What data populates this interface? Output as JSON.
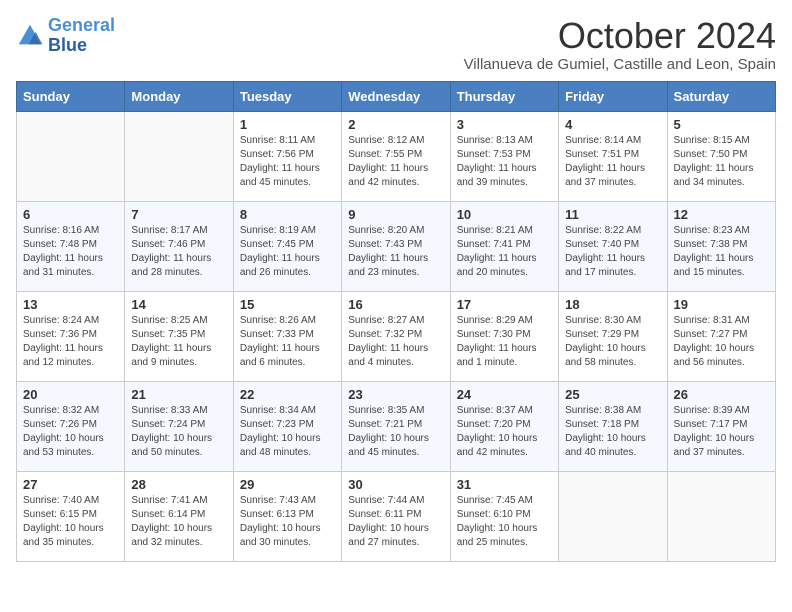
{
  "logo": {
    "line1": "General",
    "line2": "Blue"
  },
  "title": "October 2024",
  "subtitle": "Villanueva de Gumiel, Castille and Leon, Spain",
  "days_of_week": [
    "Sunday",
    "Monday",
    "Tuesday",
    "Wednesday",
    "Thursday",
    "Friday",
    "Saturday"
  ],
  "weeks": [
    [
      {
        "day": "",
        "detail": ""
      },
      {
        "day": "",
        "detail": ""
      },
      {
        "day": "1",
        "detail": "Sunrise: 8:11 AM\nSunset: 7:56 PM\nDaylight: 11 hours and 45 minutes."
      },
      {
        "day": "2",
        "detail": "Sunrise: 8:12 AM\nSunset: 7:55 PM\nDaylight: 11 hours and 42 minutes."
      },
      {
        "day": "3",
        "detail": "Sunrise: 8:13 AM\nSunset: 7:53 PM\nDaylight: 11 hours and 39 minutes."
      },
      {
        "day": "4",
        "detail": "Sunrise: 8:14 AM\nSunset: 7:51 PM\nDaylight: 11 hours and 37 minutes."
      },
      {
        "day": "5",
        "detail": "Sunrise: 8:15 AM\nSunset: 7:50 PM\nDaylight: 11 hours and 34 minutes."
      }
    ],
    [
      {
        "day": "6",
        "detail": "Sunrise: 8:16 AM\nSunset: 7:48 PM\nDaylight: 11 hours and 31 minutes."
      },
      {
        "day": "7",
        "detail": "Sunrise: 8:17 AM\nSunset: 7:46 PM\nDaylight: 11 hours and 28 minutes."
      },
      {
        "day": "8",
        "detail": "Sunrise: 8:19 AM\nSunset: 7:45 PM\nDaylight: 11 hours and 26 minutes."
      },
      {
        "day": "9",
        "detail": "Sunrise: 8:20 AM\nSunset: 7:43 PM\nDaylight: 11 hours and 23 minutes."
      },
      {
        "day": "10",
        "detail": "Sunrise: 8:21 AM\nSunset: 7:41 PM\nDaylight: 11 hours and 20 minutes."
      },
      {
        "day": "11",
        "detail": "Sunrise: 8:22 AM\nSunset: 7:40 PM\nDaylight: 11 hours and 17 minutes."
      },
      {
        "day": "12",
        "detail": "Sunrise: 8:23 AM\nSunset: 7:38 PM\nDaylight: 11 hours and 15 minutes."
      }
    ],
    [
      {
        "day": "13",
        "detail": "Sunrise: 8:24 AM\nSunset: 7:36 PM\nDaylight: 11 hours and 12 minutes."
      },
      {
        "day": "14",
        "detail": "Sunrise: 8:25 AM\nSunset: 7:35 PM\nDaylight: 11 hours and 9 minutes."
      },
      {
        "day": "15",
        "detail": "Sunrise: 8:26 AM\nSunset: 7:33 PM\nDaylight: 11 hours and 6 minutes."
      },
      {
        "day": "16",
        "detail": "Sunrise: 8:27 AM\nSunset: 7:32 PM\nDaylight: 11 hours and 4 minutes."
      },
      {
        "day": "17",
        "detail": "Sunrise: 8:29 AM\nSunset: 7:30 PM\nDaylight: 11 hours and 1 minute."
      },
      {
        "day": "18",
        "detail": "Sunrise: 8:30 AM\nSunset: 7:29 PM\nDaylight: 10 hours and 58 minutes."
      },
      {
        "day": "19",
        "detail": "Sunrise: 8:31 AM\nSunset: 7:27 PM\nDaylight: 10 hours and 56 minutes."
      }
    ],
    [
      {
        "day": "20",
        "detail": "Sunrise: 8:32 AM\nSunset: 7:26 PM\nDaylight: 10 hours and 53 minutes."
      },
      {
        "day": "21",
        "detail": "Sunrise: 8:33 AM\nSunset: 7:24 PM\nDaylight: 10 hours and 50 minutes."
      },
      {
        "day": "22",
        "detail": "Sunrise: 8:34 AM\nSunset: 7:23 PM\nDaylight: 10 hours and 48 minutes."
      },
      {
        "day": "23",
        "detail": "Sunrise: 8:35 AM\nSunset: 7:21 PM\nDaylight: 10 hours and 45 minutes."
      },
      {
        "day": "24",
        "detail": "Sunrise: 8:37 AM\nSunset: 7:20 PM\nDaylight: 10 hours and 42 minutes."
      },
      {
        "day": "25",
        "detail": "Sunrise: 8:38 AM\nSunset: 7:18 PM\nDaylight: 10 hours and 40 minutes."
      },
      {
        "day": "26",
        "detail": "Sunrise: 8:39 AM\nSunset: 7:17 PM\nDaylight: 10 hours and 37 minutes."
      }
    ],
    [
      {
        "day": "27",
        "detail": "Sunrise: 7:40 AM\nSunset: 6:15 PM\nDaylight: 10 hours and 35 minutes."
      },
      {
        "day": "28",
        "detail": "Sunrise: 7:41 AM\nSunset: 6:14 PM\nDaylight: 10 hours and 32 minutes."
      },
      {
        "day": "29",
        "detail": "Sunrise: 7:43 AM\nSunset: 6:13 PM\nDaylight: 10 hours and 30 minutes."
      },
      {
        "day": "30",
        "detail": "Sunrise: 7:44 AM\nSunset: 6:11 PM\nDaylight: 10 hours and 27 minutes."
      },
      {
        "day": "31",
        "detail": "Sunrise: 7:45 AM\nSunset: 6:10 PM\nDaylight: 10 hours and 25 minutes."
      },
      {
        "day": "",
        "detail": ""
      },
      {
        "day": "",
        "detail": ""
      }
    ]
  ]
}
